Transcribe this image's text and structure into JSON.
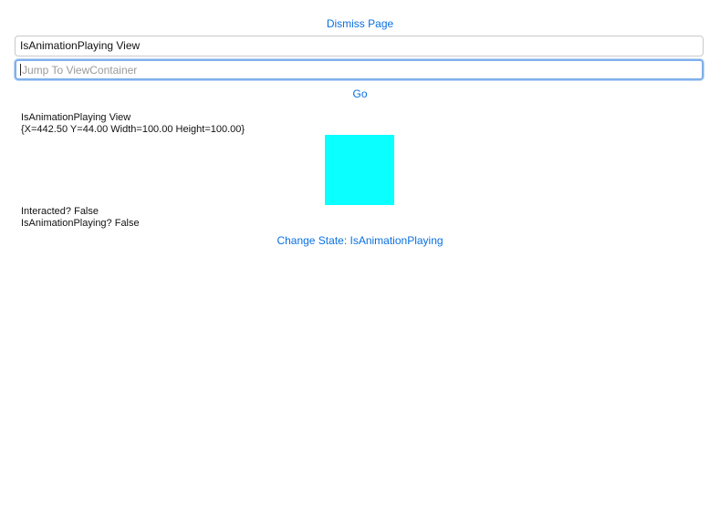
{
  "colors": {
    "link": "#0a70e0",
    "square": "#0affff"
  },
  "header": {
    "dismiss_label": "Dismiss Page"
  },
  "form": {
    "title_value": "IsAnimationPlaying View",
    "jump_placeholder": "Jump To ViewContainer",
    "go_label": "Go"
  },
  "view": {
    "name": "IsAnimationPlaying View",
    "frame": "{X=442.50 Y=44.00 Width=100.00 Height=100.00}",
    "interacted_text": "Interacted? False",
    "animation_playing_text": "IsAnimationPlaying? False",
    "change_state_label": "Change State: IsAnimationPlaying"
  }
}
